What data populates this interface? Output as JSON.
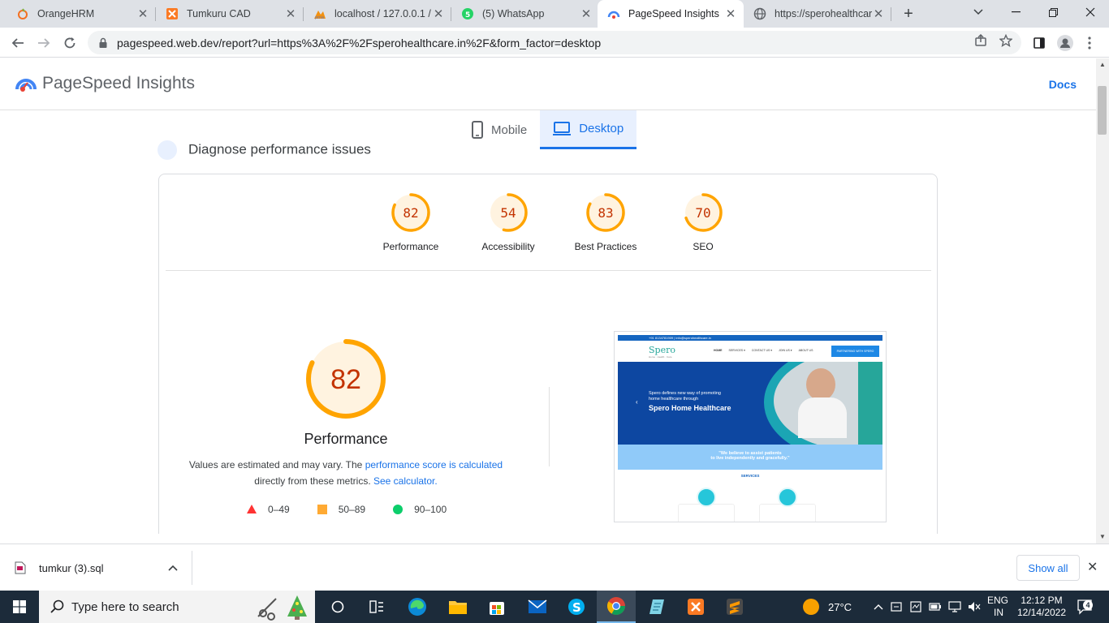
{
  "browser": {
    "tabs": [
      {
        "title": "OrangeHRM",
        "icon": "orangehrm-icon"
      },
      {
        "title": "Tumkuru CAD",
        "icon": "xampp-icon"
      },
      {
        "title": "localhost / 127.0.0.1 /",
        "icon": "phpmyadmin-icon"
      },
      {
        "title": "(5) WhatsApp",
        "icon": "whatsapp-icon"
      },
      {
        "title": "PageSpeed Insights",
        "icon": "pagespeed-icon",
        "active": true
      },
      {
        "title": "https://sperohealthcare",
        "icon": "globe-icon"
      }
    ],
    "url": "pagespeed.web.dev/report?url=https%3A%2F%2Fsperohealthcare.in%2F&form_factor=desktop"
  },
  "psi": {
    "title": "PageSpeed Insights",
    "docs": "Docs",
    "diagnose": "Diagnose performance issues",
    "form_factors": {
      "mobile": "Mobile",
      "desktop": "Desktop"
    },
    "scores": [
      {
        "label": "Performance",
        "value": "82"
      },
      {
        "label": "Accessibility",
        "value": "54"
      },
      {
        "label": "Best Practices",
        "value": "83"
      },
      {
        "label": "SEO",
        "value": "70"
      }
    ],
    "main_score": "82",
    "main_label": "Performance",
    "desc_text1": "Values are estimated and may vary. The",
    "desc_link1": "performance score is calculated",
    "desc_text2": "directly from these metrics.",
    "desc_link2": "See calculator.",
    "legend": [
      {
        "range": "0–49",
        "color": "#ff3333"
      },
      {
        "range": "50–89",
        "color": "#ffaa33"
      },
      {
        "range": "90–100",
        "color": "#0cce6b"
      }
    ],
    "colors": {
      "average": "#ffa400",
      "average_text": "#c33300",
      "average_bg": "#fff3e0",
      "accent": "#1a73e8"
    }
  },
  "screenshot": {
    "topbar": "+91 8134781909 | info@sperohealthcare.in",
    "logo": "Spero",
    "logo_tag": "Home · Health · Care",
    "nav": [
      "HOME",
      "SERVICES ▾",
      "CONTACT US ▾",
      "JOIN US ▾",
      "ABOUT US"
    ],
    "nav_cta": "PARTNERING WITH SPERO",
    "hero_line1": "Spero defines new way of promoting",
    "hero_line2": "home healthcare through",
    "hero_title": "Spero Home Healthcare",
    "quote1": "\"We believe to assist patients",
    "quote2": "to live independently and gracefully.\"",
    "services": "SERVICES"
  },
  "downloads": {
    "file": "tumkur (3).sql",
    "show_all": "Show all"
  },
  "taskbar": {
    "search_placeholder": "Type here to search",
    "temp": "27°C",
    "lang1": "ENG",
    "lang2": "IN",
    "time": "12:12 PM",
    "date": "12/14/2022",
    "notif_count": "4"
  }
}
